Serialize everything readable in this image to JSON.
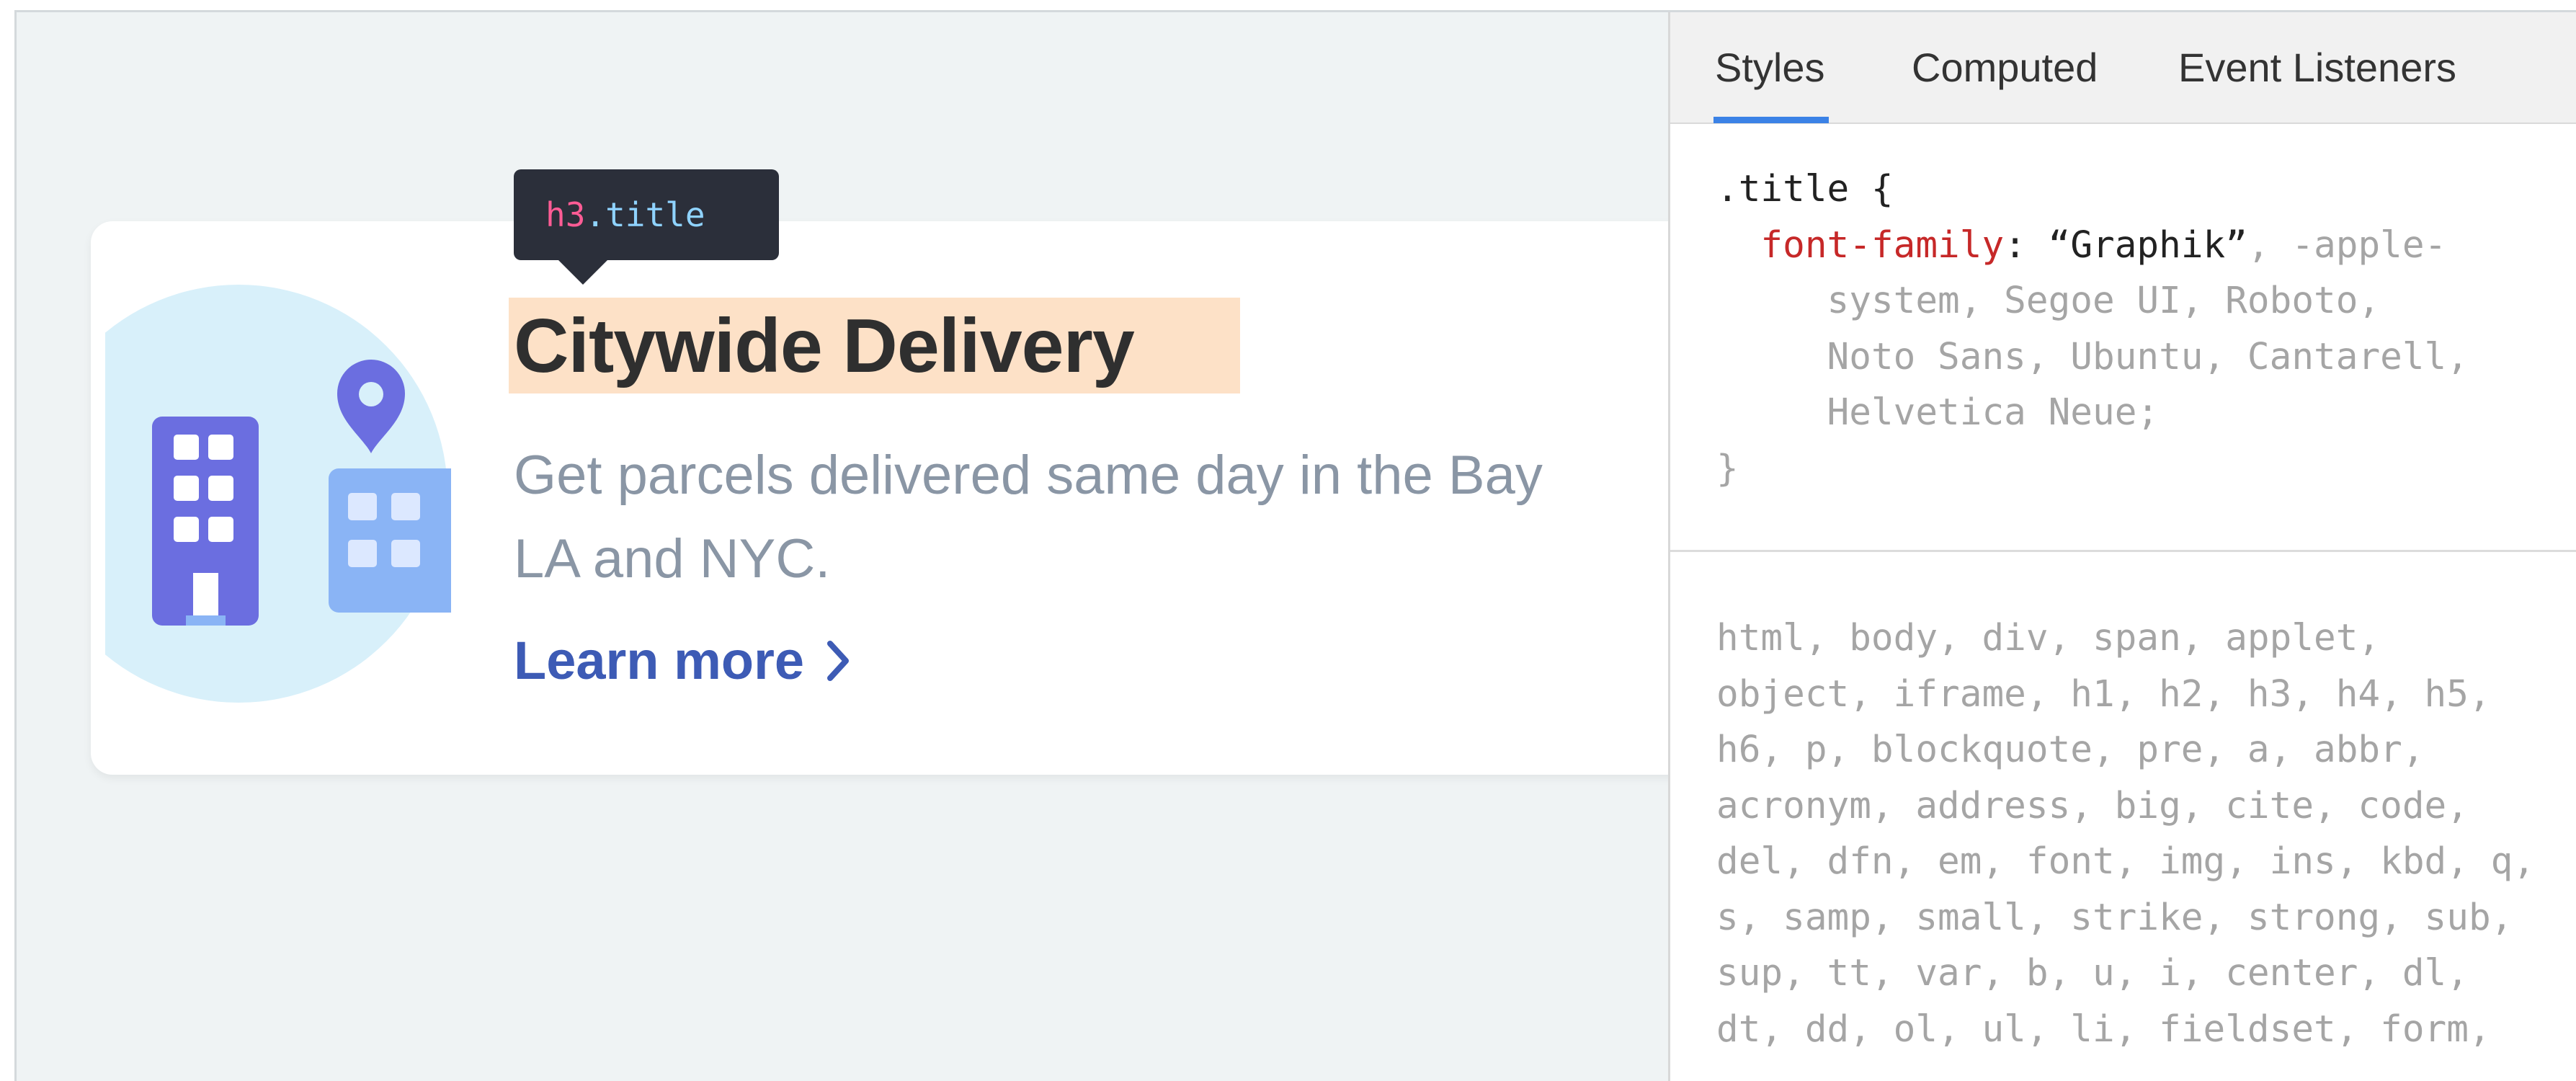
{
  "tooltip": {
    "tag": "h3",
    "class": ".title"
  },
  "card": {
    "title": "Citywide Delivery",
    "description_line1": "Get parcels delivered same day in the Bay",
    "description_line2": "LA and NYC.",
    "link_label": "Learn more",
    "link_icon": "chevron-right-icon",
    "illustration_icon": "city-buildings-location-icon"
  },
  "devtools": {
    "tabs": [
      "Styles",
      "Computed",
      "Event Listeners"
    ],
    "active_tab": "Styles",
    "rule": {
      "selector": ".title {",
      "property": "font-family",
      "colon": ": ",
      "value_primary": "“Graphik”",
      "value_rest_line1": ", -apple-",
      "value_line2": "system, Segoe UI, Roboto,",
      "value_line3": "Noto Sans, Ubuntu, Cantarell,",
      "value_line4": "Helvetica Neue;",
      "close": "}"
    },
    "reset_selectors": "html, body, div, span, applet, object, iframe, h1, h2, h3, h4, h5, h6, p, blockquote, pre, a, abbr, acronym, address, big, cite, code, del, dfn, em, font, img, ins, kbd, q, s, samp, small, strike, strong, sub, sup, tt, var, b, u, i, center, dl, dt, dd, ol, ul, li, fieldset, form,"
  },
  "colors": {
    "page_bg": "#eff3f4",
    "highlight": "#fde1c7",
    "link": "#3d5bb5",
    "tab_active_underline": "#3b82e6",
    "css_property": "#c62828",
    "illustration_primary": "#6b6ee0",
    "illustration_secondary": "#8ab4f5",
    "illustration_circle": "#d8f0fa"
  }
}
